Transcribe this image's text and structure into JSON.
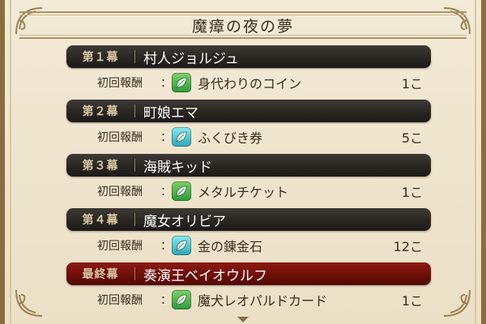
{
  "window": {
    "title": "魔瘴の夜の夢"
  },
  "rewards": [
    {
      "act": "第１幕",
      "name": "村人ジョルジュ",
      "label": "初回報酬",
      "colon": "：",
      "icon": "green-leaf-icon",
      "item": "身代わりのコイン",
      "qty": "1こ",
      "final": false
    },
    {
      "act": "第２幕",
      "name": "町娘エマ",
      "label": "初回報酬",
      "colon": "：",
      "icon": "cyan-leaf-icon",
      "item": "ふくびき券",
      "qty": "5こ",
      "final": false
    },
    {
      "act": "第３幕",
      "name": "海賊キッド",
      "label": "初回報酬",
      "colon": "：",
      "icon": "green-leaf-icon",
      "item": "メタルチケット",
      "qty": "1こ",
      "final": false
    },
    {
      "act": "第４幕",
      "name": "魔女オリビア",
      "label": "初回報酬",
      "colon": "：",
      "icon": "cyan-leaf-icon",
      "item": "金の錬金石",
      "qty": "12こ",
      "final": false
    },
    {
      "act": "最終幕",
      "name": "奏演王ベイオウルフ",
      "label": "初回報酬",
      "colon": "：",
      "icon": "green-leaf-icon",
      "item": "魔犬レオパルドカード",
      "qty": "1こ",
      "final": true
    }
  ],
  "colors": {
    "header_dark": "#2a2622",
    "header_final": "#6e0f0a",
    "parchment": "#efe4cd",
    "leaf_green": "#2f9a3a",
    "leaf_cyan": "#2aa7b9"
  }
}
